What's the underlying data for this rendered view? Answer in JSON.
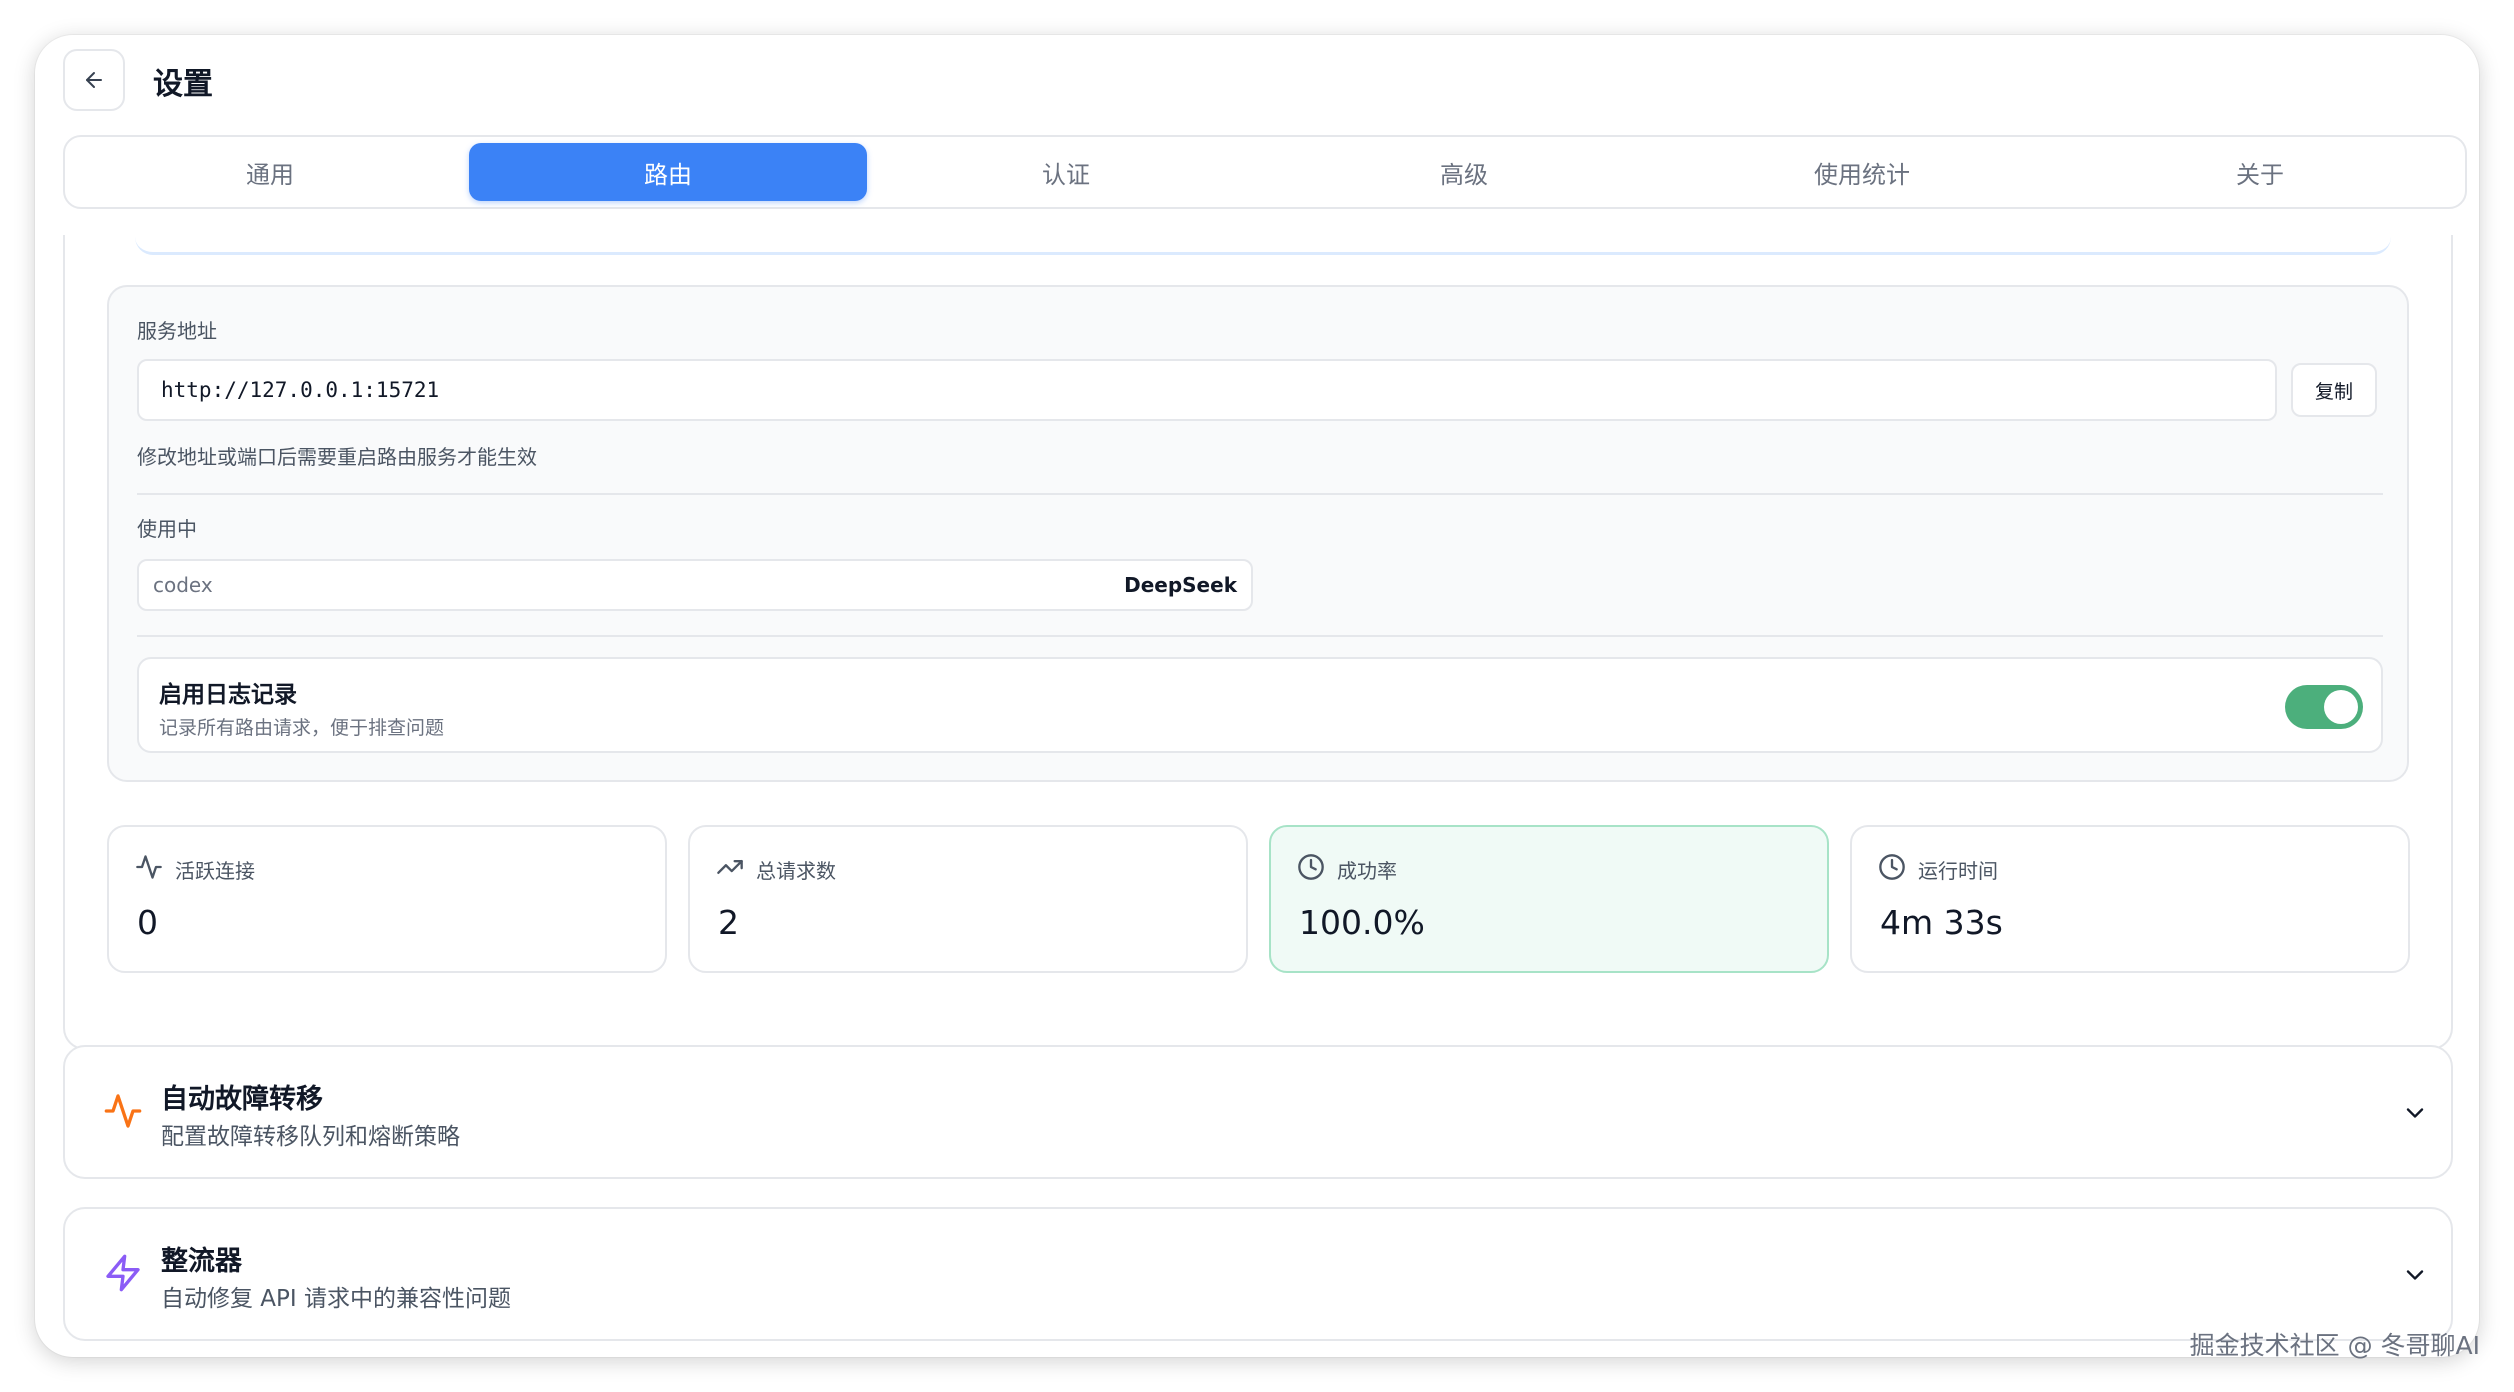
{
  "header": {
    "title": "设置"
  },
  "tabs": [
    {
      "label": "通用",
      "active": false
    },
    {
      "label": "路由",
      "active": true
    },
    {
      "label": "认证",
      "active": false
    },
    {
      "label": "高级",
      "active": false
    },
    {
      "label": "使用统计",
      "active": false
    },
    {
      "label": "关于",
      "active": false
    }
  ],
  "service": {
    "label": "服务地址",
    "address": "http://127.0.0.1:15721",
    "copy_label": "复制",
    "hint": "修改地址或端口后需要重启路由服务才能生效"
  },
  "in_use": {
    "label": "使用中",
    "app": "codex",
    "provider": "DeepSeek"
  },
  "logging": {
    "title": "启用日志记录",
    "description": "记录所有路由请求，便于排查问题",
    "enabled": true
  },
  "stats": [
    {
      "label": "活跃连接",
      "value": "0",
      "icon": "activity-icon"
    },
    {
      "label": "总请求数",
      "value": "2",
      "icon": "trending-up-icon"
    },
    {
      "label": "成功率",
      "value": "100.0%",
      "icon": "clock-icon"
    },
    {
      "label": "运行时间",
      "value": "4m 33s",
      "icon": "clock-icon"
    }
  ],
  "sections": [
    {
      "title": "自动故障转移",
      "description": "配置故障转移队列和熔断策略",
      "icon": "activity-icon",
      "color": "#f97316"
    },
    {
      "title": "整流器",
      "description": "自动修复 API 请求中的兼容性问题",
      "icon": "zap-icon",
      "color": "#8b5cf6"
    }
  ],
  "colors": {
    "accent": "#3b82f6",
    "toggle_on": "#4caf7c",
    "success_bg": "#f0faf6"
  },
  "watermark": "掘金技术社区 @ 冬哥聊AI"
}
